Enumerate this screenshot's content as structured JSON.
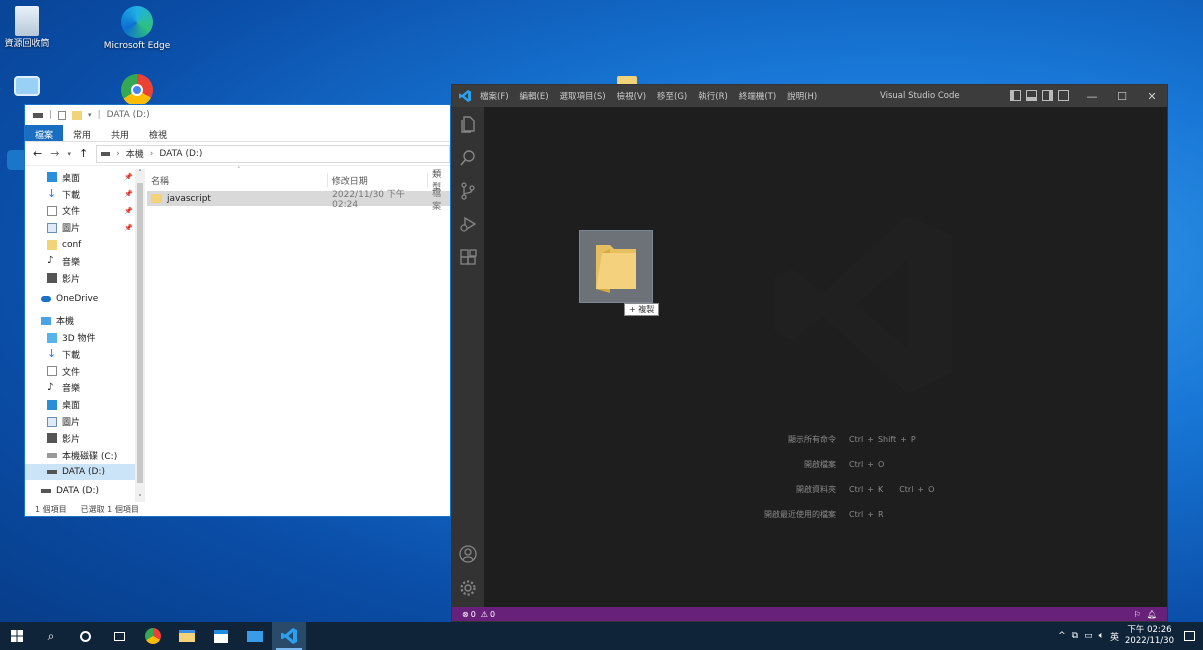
{
  "desktop": {
    "icons": [
      {
        "label": "資源回收筒",
        "icon": "recycle-bin-icon"
      },
      {
        "label": "Microsoft Edge",
        "icon": "edge-icon"
      },
      {
        "label": "Google Chrome",
        "icon": "chrome-icon"
      }
    ]
  },
  "explorer": {
    "title": "DATA (D:)",
    "ribbon_tabs": [
      "檔案",
      "常用",
      "共用",
      "檢視"
    ],
    "breadcrumb": [
      "本機",
      "DATA (D:)"
    ],
    "nav_items": [
      {
        "label": "桌面",
        "pinned": true
      },
      {
        "label": "下載",
        "pinned": true
      },
      {
        "label": "文件",
        "pinned": true
      },
      {
        "label": "圖片",
        "pinned": true
      },
      {
        "label": "conf",
        "pinned": false
      },
      {
        "label": "音樂",
        "pinned": false
      },
      {
        "label": "影片",
        "pinned": false
      },
      {
        "label": "OneDrive",
        "pinned": false
      },
      {
        "label": "本機",
        "pinned": false
      },
      {
        "label": "3D 物件",
        "pinned": false
      },
      {
        "label": "下載",
        "pinned": false
      },
      {
        "label": "文件",
        "pinned": false
      },
      {
        "label": "音樂",
        "pinned": false
      },
      {
        "label": "桌面",
        "pinned": false
      },
      {
        "label": "圖片",
        "pinned": false
      },
      {
        "label": "影片",
        "pinned": false
      },
      {
        "label": "本機磁碟 (C:)",
        "pinned": false
      },
      {
        "label": "DATA (D:)",
        "pinned": false
      },
      {
        "label": "DATA (D:)",
        "pinned": false
      }
    ],
    "columns": [
      "名稱",
      "修改日期",
      "類型"
    ],
    "files": [
      {
        "name": "javascript",
        "modified": "2022/11/30 下午 02:24",
        "type": "檔案"
      }
    ],
    "status_left": "1 個項目",
    "status_right": "已選取 1 個項目"
  },
  "vscode": {
    "title": "Visual Studio Code",
    "menu": [
      "檔案(F)",
      "編輯(E)",
      "選取項目(S)",
      "檢視(V)",
      "移至(G)",
      "執行(R)",
      "終端機(T)",
      "說明(H)"
    ],
    "drag_label": "+ 複製",
    "shortcuts": [
      {
        "label": "顯示所有命令",
        "keys": [
          "Ctrl",
          "+",
          "Shift",
          "+",
          "P"
        ],
        "keys2": []
      },
      {
        "label": "開啟檔案",
        "keys": [
          "Ctrl",
          "+",
          "O"
        ],
        "keys2": []
      },
      {
        "label": "開啟資料夾",
        "keys": [
          "Ctrl",
          "+",
          "K"
        ],
        "keys2": [
          "Ctrl",
          "+",
          "O"
        ]
      },
      {
        "label": "開啟最近使用的檔案",
        "keys": [
          "Ctrl",
          "+",
          "R"
        ],
        "keys2": []
      }
    ],
    "status": {
      "errors": "0",
      "warnings": "0"
    }
  },
  "taskbar": {
    "time": "下午 02:26",
    "date": "2022/11/30",
    "ime": "英"
  }
}
